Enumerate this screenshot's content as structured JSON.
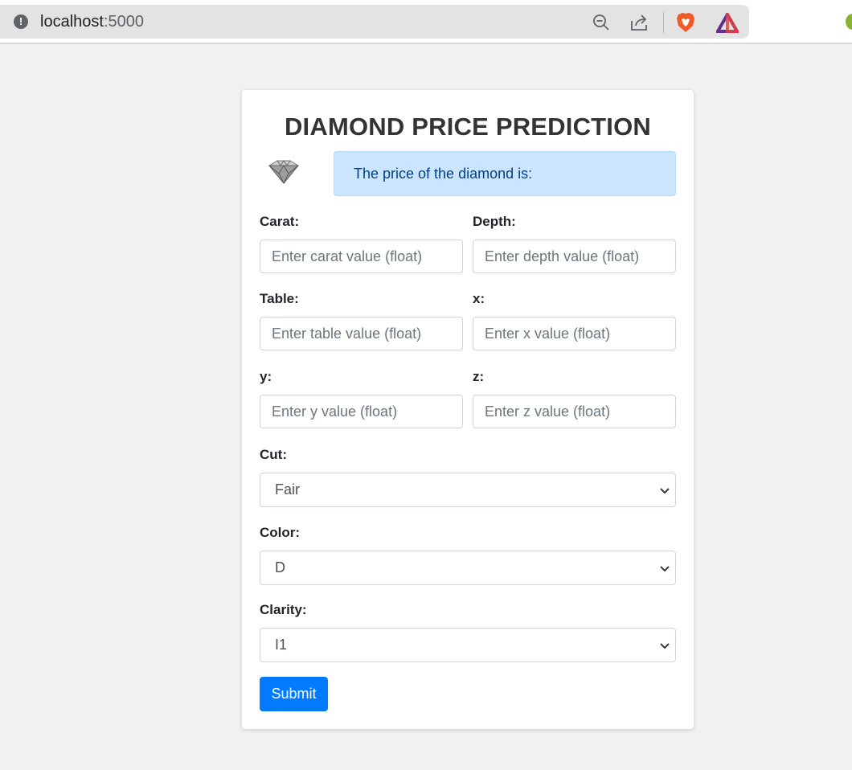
{
  "browser": {
    "url_host": "localhost",
    "url_port": ":5000",
    "icons": [
      "info-icon",
      "zoom-out-icon",
      "share-icon",
      "brave-shield-icon",
      "brave-rewards-icon"
    ]
  },
  "page": {
    "title": "DIAMOND PRICE PREDICTION",
    "result_text": "The price of the diamond is:",
    "fields": {
      "carat": {
        "label": "Carat:",
        "placeholder": "Enter carat value (float)"
      },
      "depth": {
        "label": "Depth:",
        "placeholder": "Enter depth value (float)"
      },
      "table": {
        "label": "Table:",
        "placeholder": "Enter table value (float)"
      },
      "x": {
        "label": "x:",
        "placeholder": "Enter x value (float)"
      },
      "y": {
        "label": "y:",
        "placeholder": "Enter y value (float)"
      },
      "z": {
        "label": "z:",
        "placeholder": "Enter z value (float)"
      }
    },
    "cut": {
      "label": "Cut:",
      "value": "Fair"
    },
    "color": {
      "label": "Color:",
      "value": "D"
    },
    "clarity": {
      "label": "Clarity:",
      "value": "I1"
    },
    "submit_label": "Submit"
  },
  "colors": {
    "primary": "#007bff",
    "alert_bg": "#cce5ff",
    "alert_text": "#004085",
    "page_bg": "#f1f1f1"
  }
}
